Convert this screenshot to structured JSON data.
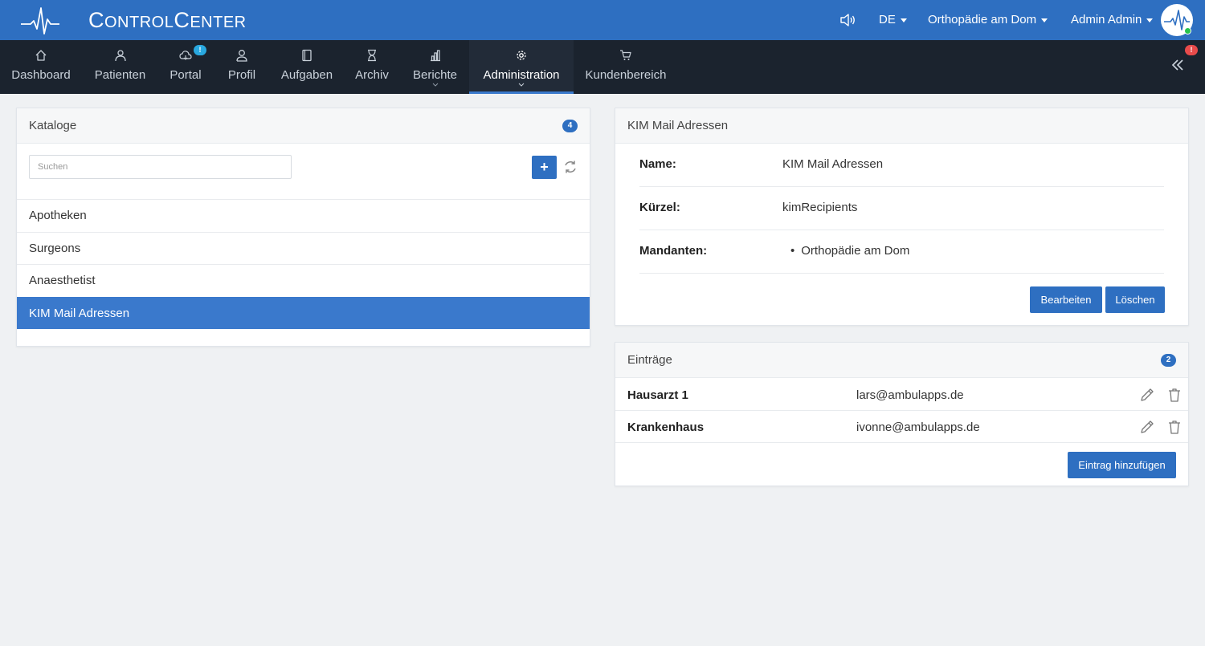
{
  "header": {
    "brand_first": "C",
    "brand_first_rest": "ONTROL",
    "brand_second": "C",
    "brand_second_rest": "ENTER",
    "language": "DE",
    "practice": "Orthopädie am Dom",
    "user": "Admin Admin",
    "online_status_color": "#27c24c"
  },
  "nav": {
    "items": [
      {
        "label": "Dashboard",
        "icon": "home-icon"
      },
      {
        "label": "Patienten",
        "icon": "patient-icon"
      },
      {
        "label": "Portal",
        "icon": "cloud-icon",
        "badge": "!"
      },
      {
        "label": "Profil",
        "icon": "user-icon"
      },
      {
        "label": "Aufgaben",
        "icon": "book-icon"
      },
      {
        "label": "Archiv",
        "icon": "hourglass-icon"
      },
      {
        "label": "Berichte",
        "icon": "bar-chart-icon"
      },
      {
        "label": "Administration",
        "icon": "gear-icon"
      },
      {
        "label": "Kundenbereich",
        "icon": "cart-icon",
        "badge": "!"
      }
    ],
    "active": "Administration"
  },
  "catalogs": {
    "title": "Kataloge",
    "count": "4",
    "search_placeholder": "Suchen",
    "add_label": "+",
    "items": [
      "Apotheken",
      "Surgeons",
      "Anaesthetist",
      "KIM Mail Adressen"
    ],
    "selected": "KIM Mail Adressen"
  },
  "details": {
    "title": "KIM Mail Adressen",
    "name_label": "Name:",
    "name_value": "KIM Mail Adressen",
    "short_label": "Kürzel:",
    "short_value": "kimRecipients",
    "clients_label": "Mandanten:",
    "clients": [
      "Orthopädie am Dom"
    ],
    "edit_label": "Bearbeiten",
    "delete_label": "Löschen"
  },
  "entries": {
    "title": "Einträge",
    "count": "2",
    "rows": [
      {
        "name": "Hausarzt 1",
        "email": "lars@ambulapps.de"
      },
      {
        "name": "Krankenhaus",
        "email": "ivonne@ambulapps.de"
      }
    ],
    "add_label": "Eintrag hinzufügen"
  },
  "colors": {
    "primary": "#2e6fc1",
    "nav_bg": "#1b232e",
    "active_row": "#3a79cc",
    "badge_portal": "#29a8e0",
    "badge_shop": "#e94b4b"
  }
}
